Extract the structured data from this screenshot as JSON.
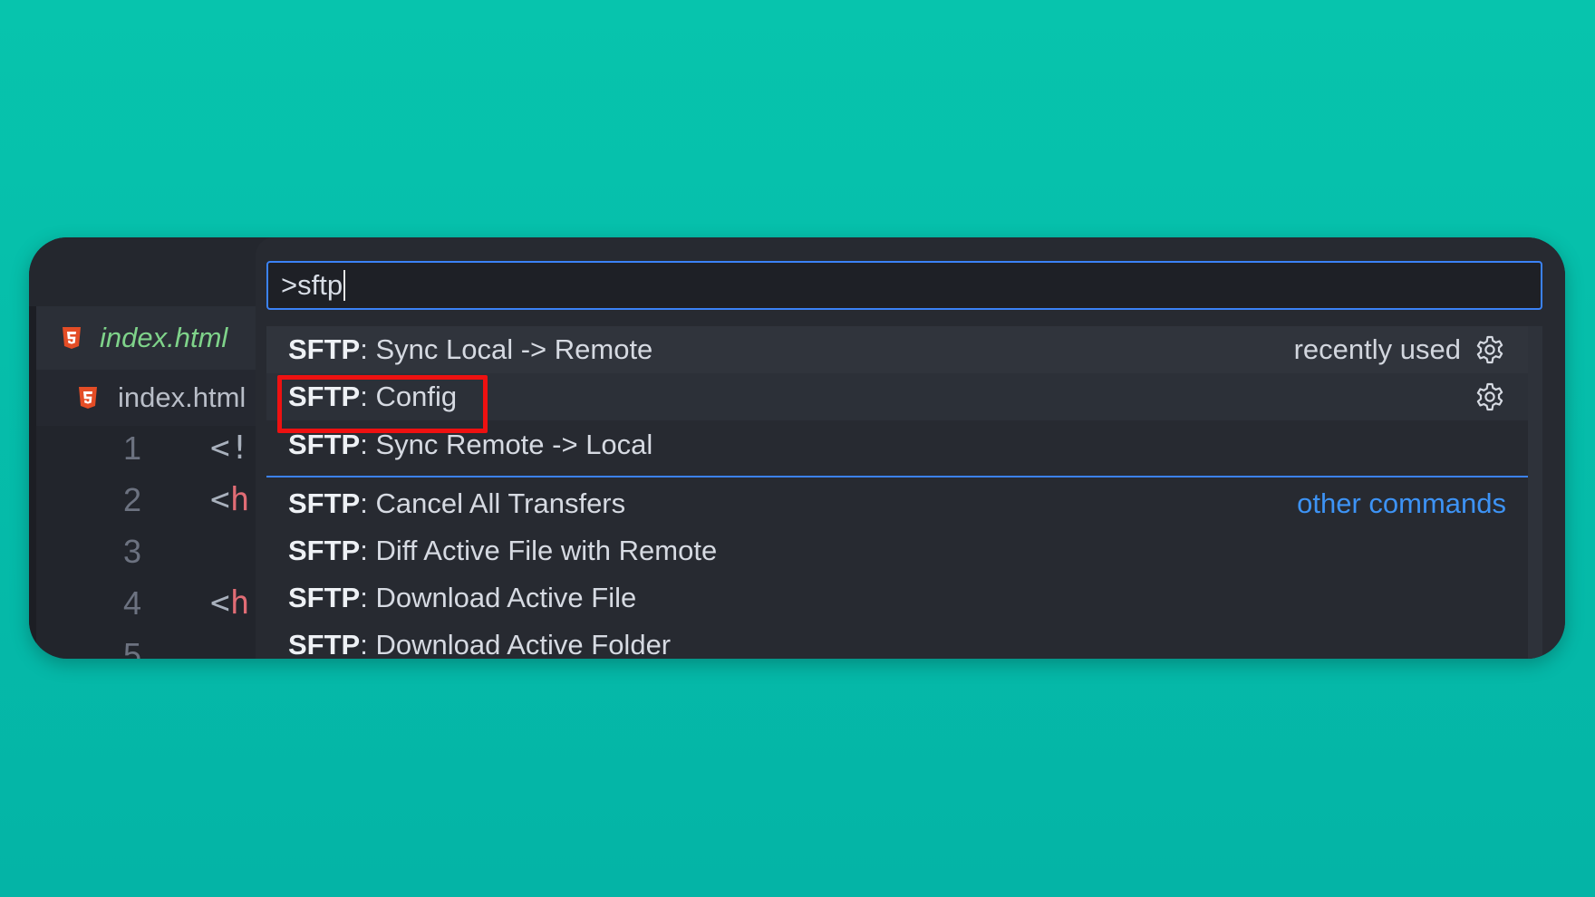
{
  "editor": {
    "tab_label": "index.html",
    "breadcrumb_label": "index.html",
    "lines": [
      {
        "num": "1",
        "code_prefix": "<!",
        "code_colored": ""
      },
      {
        "num": "2",
        "code_prefix": "<",
        "code_colored": "h"
      },
      {
        "num": "3",
        "code_prefix": "",
        "code_colored": ""
      },
      {
        "num": "4",
        "code_prefix": "<",
        "code_colored": "h"
      },
      {
        "num": "5",
        "code_prefix": "",
        "code_colored": ""
      }
    ]
  },
  "palette": {
    "query": ">sftp",
    "items": [
      {
        "prefix": "SFTP",
        "label": ": Sync Local -> Remote",
        "right_label": "recently used",
        "icon": "gear-icon"
      },
      {
        "prefix": "SFTP",
        "label": ": Config",
        "icon": "gear-icon"
      },
      {
        "prefix": "SFTP",
        "label": ": Sync Remote -> Local"
      },
      {
        "prefix": "SFTP",
        "label": ": Cancel All Transfers",
        "right_link": "other commands"
      },
      {
        "prefix": "SFTP",
        "label": ": Diff Active File with Remote"
      },
      {
        "prefix": "SFTP",
        "label": ": Download Active File"
      },
      {
        "prefix": "SFTP",
        "label": ": Download Active Folder"
      }
    ]
  },
  "colors": {
    "background": "#07c4ad",
    "accent": "#3b82f6",
    "link": "#3d93f5",
    "highlight": "#ee1111",
    "html5_icon": "#e44d26"
  }
}
